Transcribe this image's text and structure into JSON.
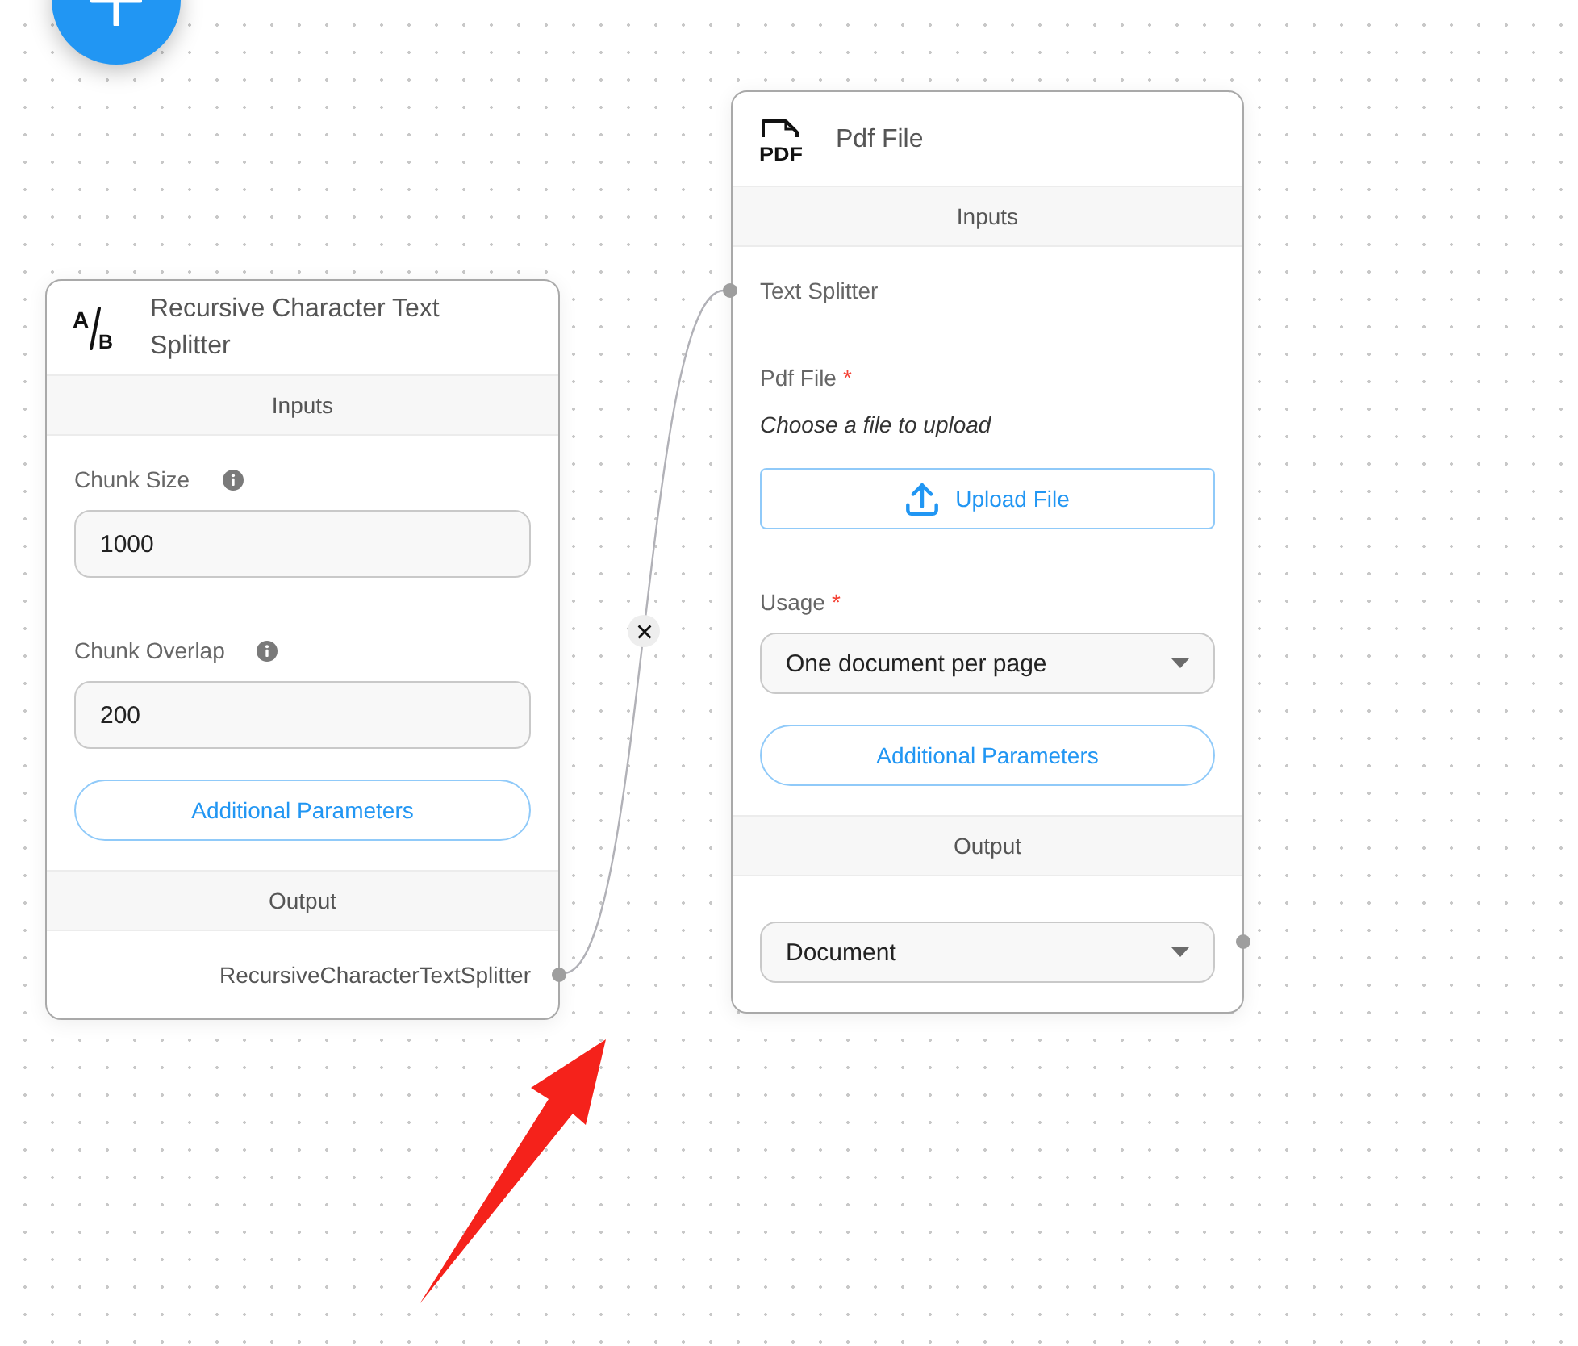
{
  "nodes": [
    {
      "title": "Recursive Character Text Splitter",
      "icon": {
        "kind": "split",
        "text": [
          "A",
          "B"
        ]
      },
      "inputs_heading": "Inputs",
      "inputs": [
        {
          "kind": "number",
          "label": "Chunk Size",
          "info": true,
          "value": "1000"
        },
        {
          "kind": "number",
          "label": "Chunk Overlap",
          "info": true,
          "value": "200"
        }
      ],
      "additional_button": "Additional Parameters",
      "output_heading": "Output",
      "output": {
        "kind": "text",
        "label": "RecursiveCharacterTextSplitter"
      }
    },
    {
      "title": "Pdf File",
      "icon": {
        "kind": "file",
        "text": [
          "PDF"
        ]
      },
      "inputs_heading": "Inputs",
      "inputs": [
        {
          "kind": "anchor",
          "label": "Text Splitter",
          "info": false
        },
        {
          "kind": "file",
          "label": "Pdf File",
          "required_mark": "*",
          "info": false,
          "hint": "Choose a file to upload",
          "button": "Upload File"
        },
        {
          "kind": "select",
          "label": "Usage",
          "required_mark": "*",
          "info": false,
          "value": "One document per page"
        }
      ],
      "additional_button": "Additional Parameters",
      "output_heading": "Output",
      "output": {
        "kind": "select",
        "value": "Document"
      }
    }
  ]
}
